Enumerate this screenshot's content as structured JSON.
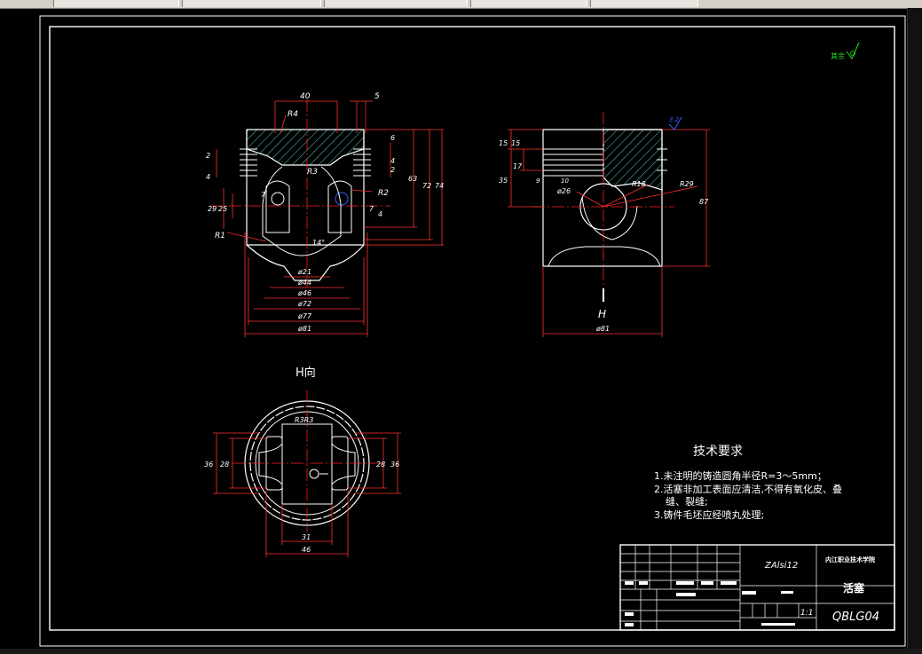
{
  "views": {
    "section": {
      "dims": {
        "w40": "40",
        "w5": "5",
        "r4": "R4",
        "r3": "R3",
        "r2": "R2",
        "r1": "R1",
        "h2": "2",
        "h4": "4",
        "h29": "29",
        "h25": "25",
        "h7a": "7",
        "h7b": "7",
        "h4b": "4",
        "v6": "6",
        "v4": "4",
        "v4b": "4",
        "v2": "2",
        "v5": "5",
        "v2b": "2",
        "v63": "63",
        "v72": "72",
        "v74": "74",
        "ang14": "14°",
        "d21": "ø21",
        "d44": "ø44",
        "d46": "ø46",
        "d72": "ø72",
        "d77": "ø77",
        "d81": "ø81"
      }
    },
    "side": {
      "dims": {
        "h15a": "15",
        "h15b": "15",
        "h17": "17",
        "h35": "35",
        "h9": "9",
        "h10": "10",
        "d26": "ø26",
        "r18": "R18",
        "r29": "R29",
        "v87": "87",
        "d81": "ø81",
        "rough": "3.2"
      },
      "view_marker": "H"
    },
    "bottom": {
      "title": "H向",
      "dims": {
        "r3": "R3R3",
        "l36": "36",
        "l28": "28",
        "r28": "28",
        "r36": "36",
        "b31": "31",
        "b46": "46"
      }
    }
  },
  "roughness_note": "其余",
  "tech_req": {
    "title": "技术要求",
    "items": [
      "1.未注明的铸造圆角半径R=3～5mm；",
      "2.活塞非加工表面应清洁,不得有氧化皮、叠",
      "缝、裂缝;",
      "3.铸件毛坯应经喷丸处理;"
    ]
  },
  "title_block": {
    "material": "ZAlsi12",
    "school": "内江职业技术学院",
    "part_name": "活塞",
    "scale": "1:1",
    "drawing_no": "QBLG04"
  },
  "colors": {
    "line": "#ffffff",
    "center": "#ff2020",
    "hatch": "#4fd0c8",
    "dim": "#ff3030",
    "blue": "#3060ff",
    "green": "#20e020"
  }
}
